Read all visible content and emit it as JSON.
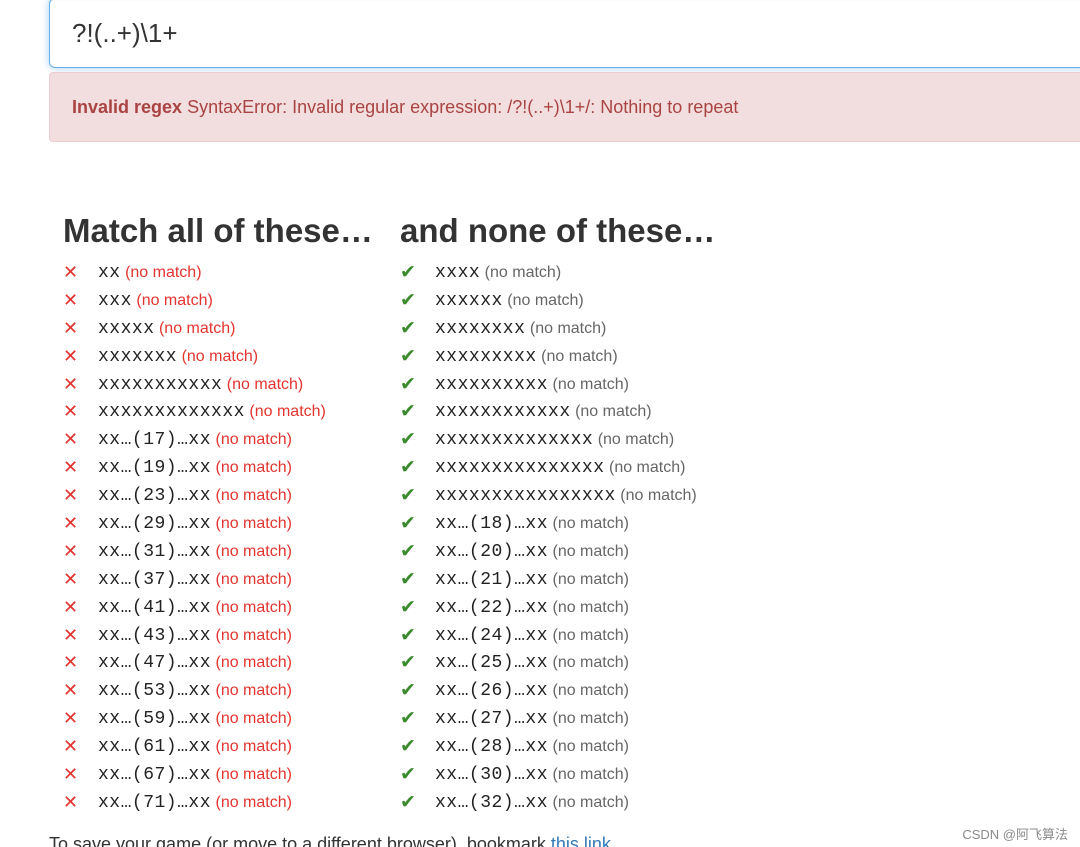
{
  "regex_input": {
    "value": "?!(..+)\\1+"
  },
  "error": {
    "label": "Invalid regex",
    "message": "SyntaxError: Invalid regular expression: /?!(..+)\\1+/: Nothing to repeat"
  },
  "match_column": {
    "heading": "Match all of these…",
    "status_icon": "cross-icon",
    "status_color": "#e3342f",
    "items": [
      {
        "word": "xx",
        "status": "(no match)"
      },
      {
        "word": "xxx",
        "status": "(no match)"
      },
      {
        "word": "xxxxx",
        "status": "(no match)"
      },
      {
        "word": "xxxxxxx",
        "status": "(no match)"
      },
      {
        "word": "xxxxxxxxxxx",
        "status": "(no match)"
      },
      {
        "word": "xxxxxxxxxxxxx",
        "status": "(no match)"
      },
      {
        "word": "xx…(17)…xx",
        "status": "(no match)"
      },
      {
        "word": "xx…(19)…xx",
        "status": "(no match)"
      },
      {
        "word": "xx…(23)…xx",
        "status": "(no match)"
      },
      {
        "word": "xx…(29)…xx",
        "status": "(no match)"
      },
      {
        "word": "xx…(31)…xx",
        "status": "(no match)"
      },
      {
        "word": "xx…(37)…xx",
        "status": "(no match)"
      },
      {
        "word": "xx…(41)…xx",
        "status": "(no match)"
      },
      {
        "word": "xx…(43)…xx",
        "status": "(no match)"
      },
      {
        "word": "xx…(47)…xx",
        "status": "(no match)"
      },
      {
        "word": "xx…(53)…xx",
        "status": "(no match)"
      },
      {
        "word": "xx…(59)…xx",
        "status": "(no match)"
      },
      {
        "word": "xx…(61)…xx",
        "status": "(no match)"
      },
      {
        "word": "xx…(67)…xx",
        "status": "(no match)"
      },
      {
        "word": "xx…(71)…xx",
        "status": "(no match)"
      }
    ]
  },
  "none_column": {
    "heading": "and none of these…",
    "status_icon": "check-icon",
    "status_color": "#3c8a2e",
    "items": [
      {
        "word": "xxxx",
        "status": "(no match)"
      },
      {
        "word": "xxxxxx",
        "status": "(no match)"
      },
      {
        "word": "xxxxxxxx",
        "status": "(no match)"
      },
      {
        "word": "xxxxxxxxx",
        "status": "(no match)"
      },
      {
        "word": "xxxxxxxxxx",
        "status": "(no match)"
      },
      {
        "word": "xxxxxxxxxxxx",
        "status": "(no match)"
      },
      {
        "word": "xxxxxxxxxxxxxx",
        "status": "(no match)"
      },
      {
        "word": "xxxxxxxxxxxxxxx",
        "status": "(no match)"
      },
      {
        "word": "xxxxxxxxxxxxxxxx",
        "status": "(no match)"
      },
      {
        "word": "xx…(18)…xx",
        "status": "(no match)"
      },
      {
        "word": "xx…(20)…xx",
        "status": "(no match)"
      },
      {
        "word": "xx…(21)…xx",
        "status": "(no match)"
      },
      {
        "word": "xx…(22)…xx",
        "status": "(no match)"
      },
      {
        "word": "xx…(24)…xx",
        "status": "(no match)"
      },
      {
        "word": "xx…(25)…xx",
        "status": "(no match)"
      },
      {
        "word": "xx…(26)…xx",
        "status": "(no match)"
      },
      {
        "word": "xx…(27)…xx",
        "status": "(no match)"
      },
      {
        "word": "xx…(28)…xx",
        "status": "(no match)"
      },
      {
        "word": "xx…(30)…xx",
        "status": "(no match)"
      },
      {
        "word": "xx…(32)…xx",
        "status": "(no match)"
      }
    ]
  },
  "footer": {
    "text": "To save your game (or move to a different browser), bookmark ",
    "link_text": "this link"
  },
  "watermark": "CSDN @阿飞算法"
}
